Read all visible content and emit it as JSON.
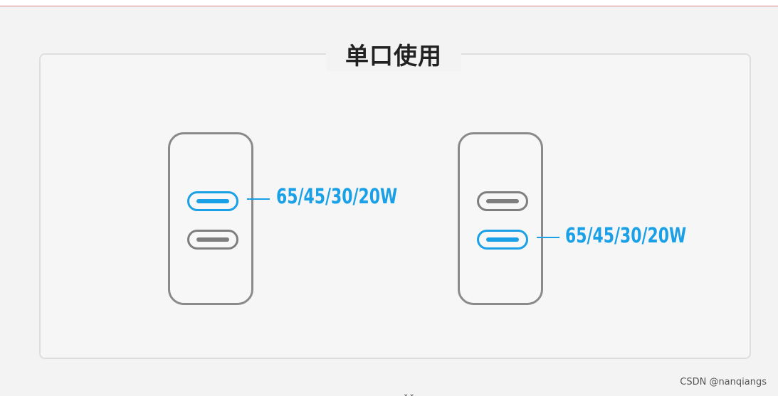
{
  "title": "单口使用",
  "diagrams": [
    {
      "label": "65/45/30/20W",
      "active_port": "top"
    },
    {
      "label": "65/45/30/20W",
      "active_port": "bottom"
    }
  ],
  "colors": {
    "active": "#1aa0e6",
    "inactive": "#7e7e7e",
    "title": "#222222"
  },
  "watermark": "CSDN @nanqiangs"
}
